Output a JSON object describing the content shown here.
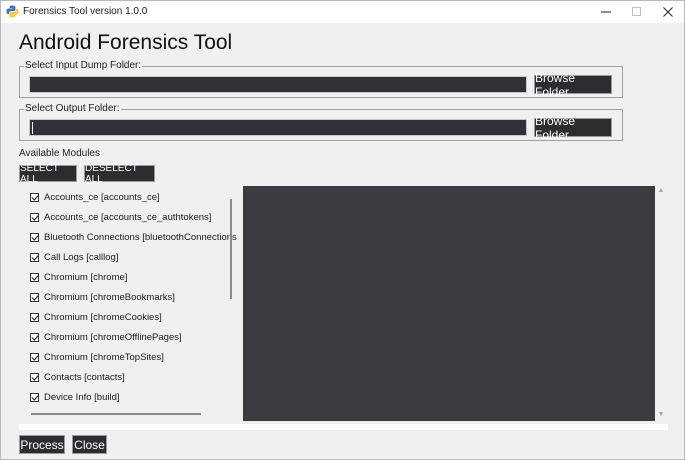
{
  "window": {
    "title": "Forensics Tool version 1.0.0"
  },
  "app_title": "Android Forensics Tool",
  "input_folder": {
    "label": "Select Input Dump Folder:",
    "value": "",
    "browse_label": "Browse Folder"
  },
  "output_folder": {
    "label": "Select Output Folder:",
    "value": "",
    "browse_label": "Browse Folder"
  },
  "modules": {
    "section_label": "Available Modules",
    "select_all_label": "SELECT ALL",
    "deselect_all_label": "DESELECT ALL",
    "items": [
      {
        "label": "Accounts_ce [accounts_ce]",
        "checked": true
      },
      {
        "label": "Accounts_ce [accounts_ce_authtokens]",
        "checked": true
      },
      {
        "label": "Bluetooth Connections [bluetoothConnections",
        "checked": true
      },
      {
        "label": "Call Logs [calllog]",
        "checked": true
      },
      {
        "label": "Chromium [chrome]",
        "checked": true
      },
      {
        "label": "Chromium [chromeBookmarks]",
        "checked": true
      },
      {
        "label": "Chromium [chromeCookies]",
        "checked": true
      },
      {
        "label": "Chromium [chromeOfflinePages]",
        "checked": true
      },
      {
        "label": "Chromium [chromeTopSites]",
        "checked": true
      },
      {
        "label": "Contacts [contacts]",
        "checked": true
      },
      {
        "label": "Device Info [build]",
        "checked": true
      }
    ]
  },
  "actions": {
    "process_label": "Process",
    "close_label": "Close"
  },
  "icons": {
    "app": "python-icon",
    "minimize": "minimize-icon",
    "maximize": "maximize-icon",
    "close": "close-icon"
  }
}
